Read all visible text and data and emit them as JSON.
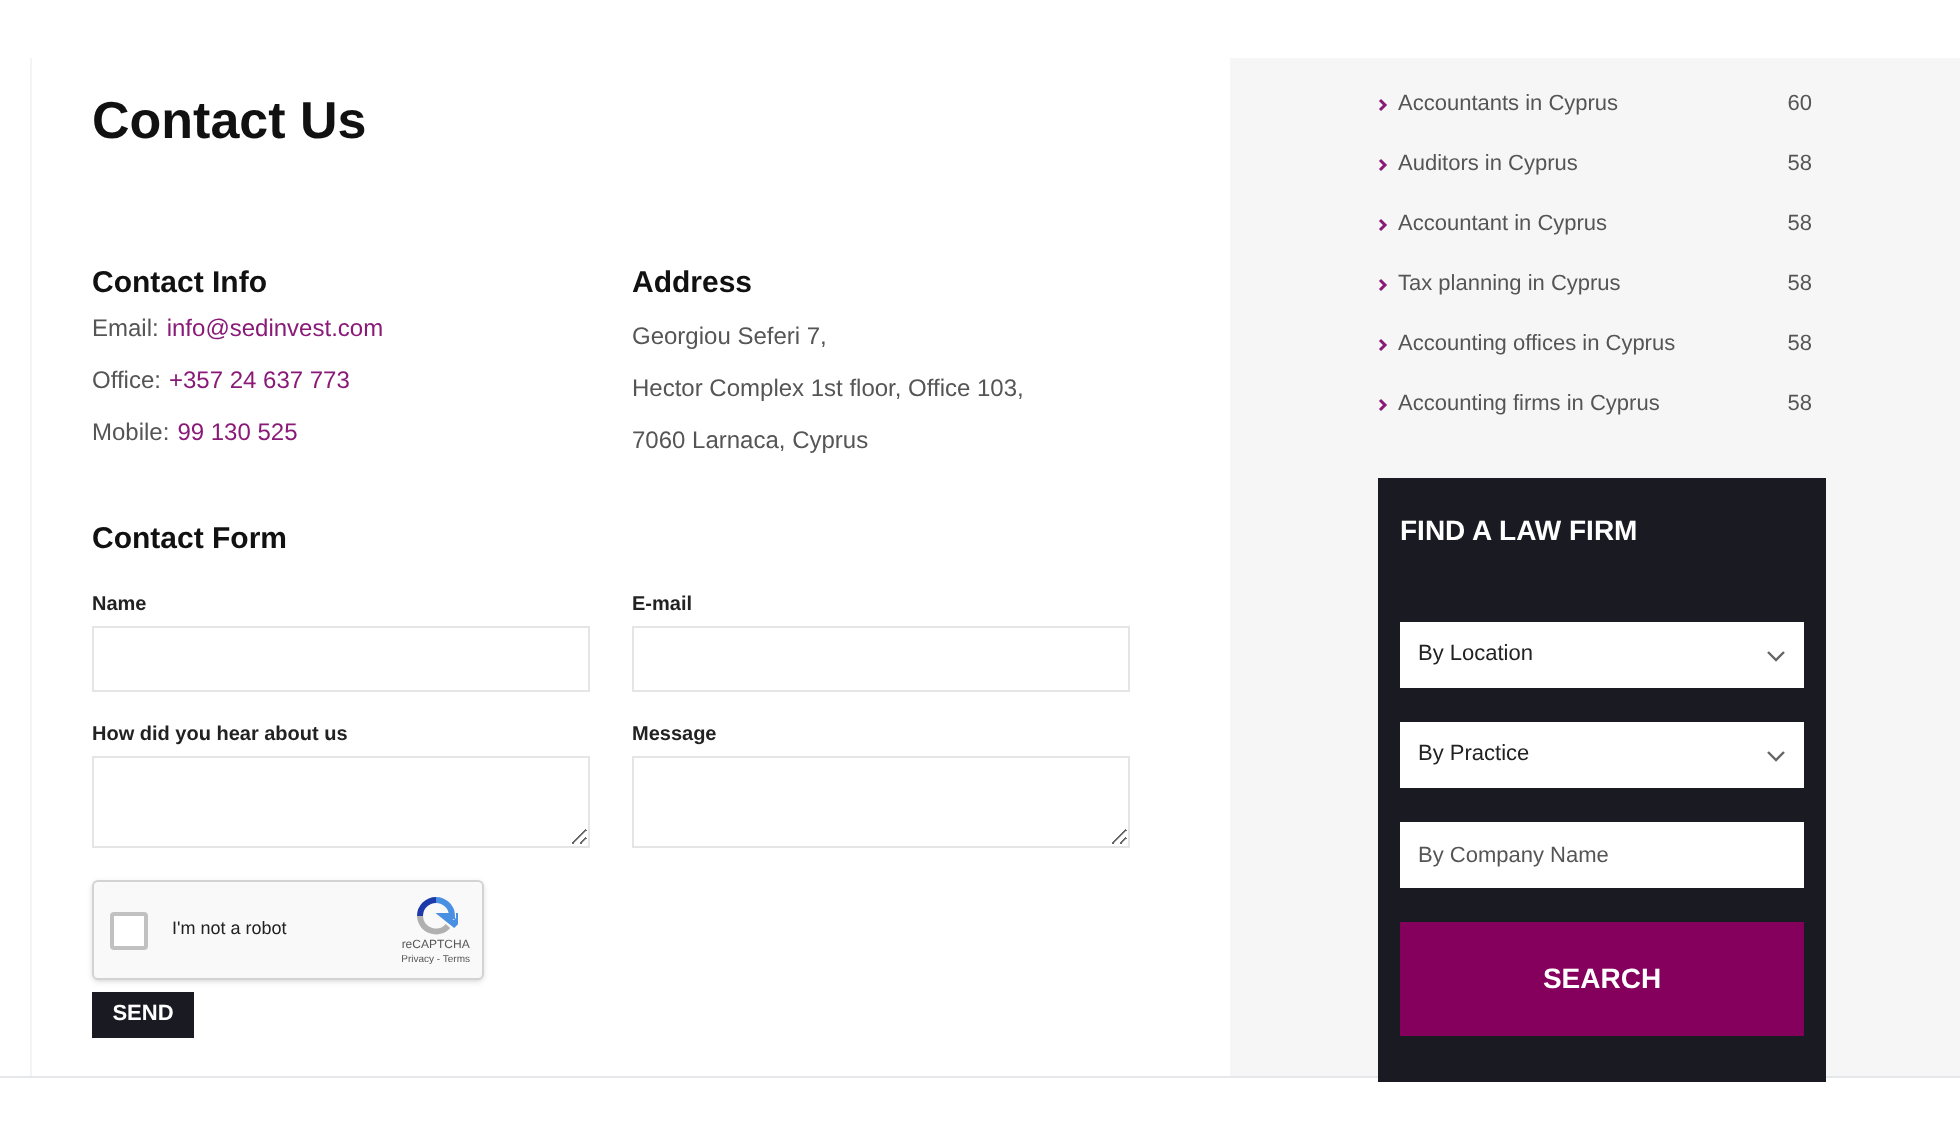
{
  "title": "Contact Us",
  "contact_info": {
    "heading": "Contact Info",
    "lines": [
      {
        "label": "Email:",
        "value": "info@sedinvest.com"
      },
      {
        "label": "Office:",
        "value": "+357 24 637 773"
      },
      {
        "label": "Mobile:",
        "value": "99 130 525"
      }
    ]
  },
  "address": {
    "heading": "Address",
    "lines": [
      "Georgiou Seferi 7,",
      "Hector Complex 1st floor, Office 103,",
      "7060 Larnaca, Cyprus"
    ]
  },
  "contact_form": {
    "heading": "Contact Form",
    "fields": [
      {
        "label": "Name",
        "kind": "input"
      },
      {
        "label": "E-mail",
        "kind": "input"
      },
      {
        "label": "How did you hear about us",
        "kind": "textarea"
      },
      {
        "label": "Message",
        "kind": "textarea"
      }
    ],
    "captcha": {
      "label": "I'm not a robot",
      "checked": false,
      "brand": "reCAPTCHA",
      "links": "Privacy - Terms"
    },
    "submit": "SEND"
  },
  "categories": [
    {
      "label": "Accountants in Cyprus",
      "count": "60"
    },
    {
      "label": "Auditors in Cyprus",
      "count": "58"
    },
    {
      "label": "Accountant in Cyprus",
      "count": "58"
    },
    {
      "label": "Tax planning in Cyprus",
      "count": "58"
    },
    {
      "label": "Accounting offices in Cyprus",
      "count": "58"
    },
    {
      "label": "Accounting firms in Cyprus",
      "count": "58"
    }
  ],
  "finder": {
    "title": "FIND A LAW FIRM",
    "fields": [
      {
        "kind": "select",
        "value": "By Location"
      },
      {
        "kind": "select",
        "value": "By Practice"
      },
      {
        "kind": "input",
        "placeholder": "By Company Name"
      }
    ],
    "button": "SEARCH"
  }
}
